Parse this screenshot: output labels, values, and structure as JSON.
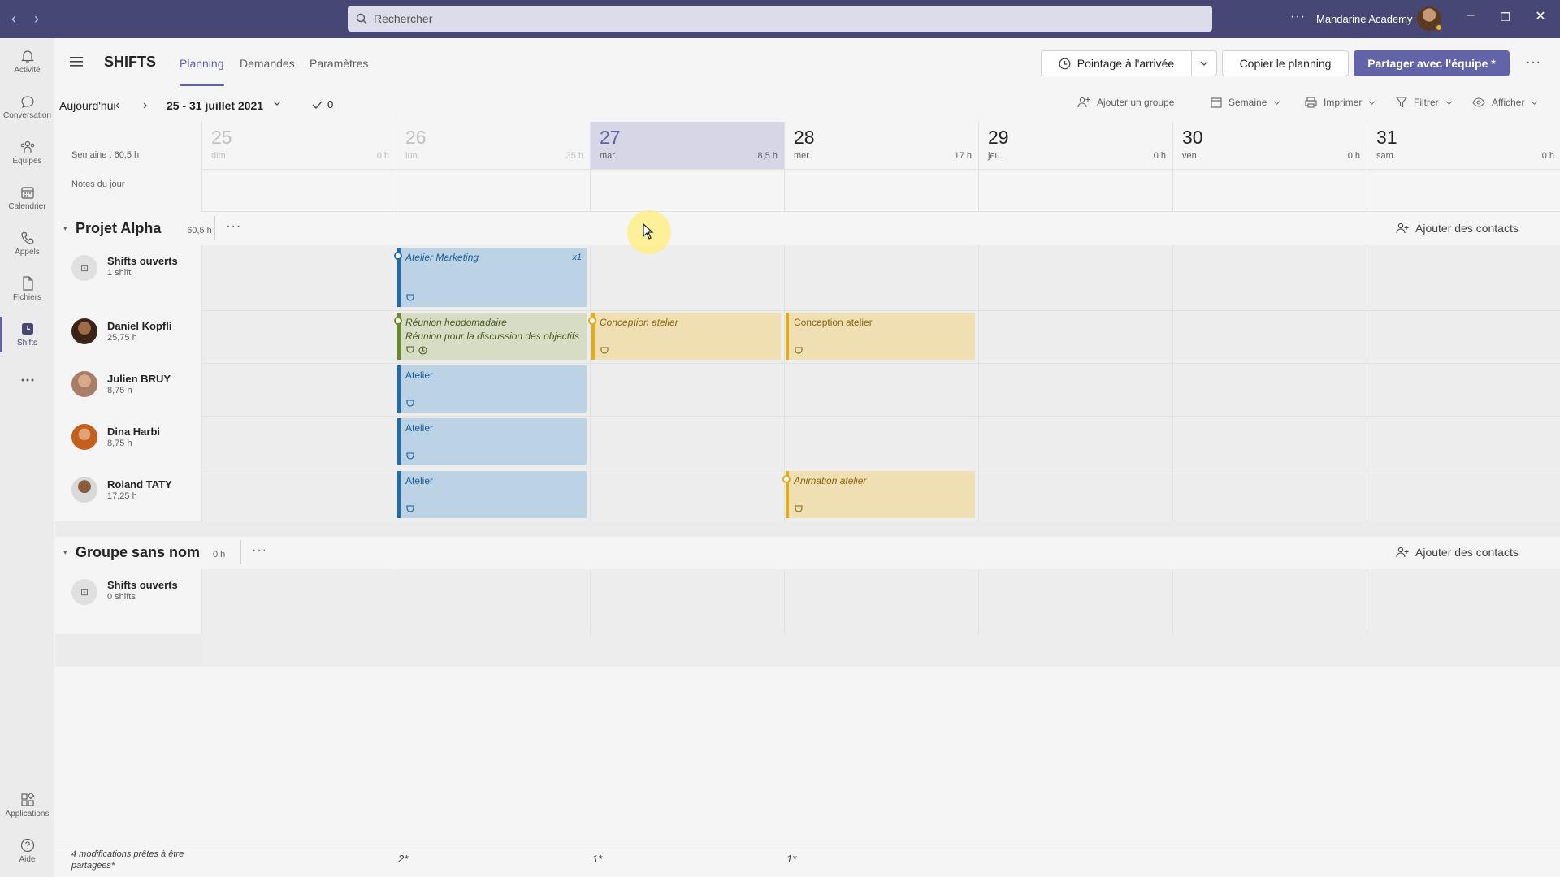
{
  "titlebar": {
    "search_placeholder": "Rechercher",
    "org_name": "Mandarine Academy",
    "more": "···"
  },
  "rail": {
    "items": [
      {
        "label": "Activité",
        "icon": "bell-icon"
      },
      {
        "label": "Conversation",
        "icon": "chat-icon"
      },
      {
        "label": "Équipes",
        "icon": "teams-icon"
      },
      {
        "label": "Calendrier",
        "icon": "calendar-icon"
      },
      {
        "label": "Appels",
        "icon": "phone-icon"
      },
      {
        "label": "Fichiers",
        "icon": "file-icon"
      },
      {
        "label": "Shifts",
        "icon": "shifts-icon",
        "active": true
      },
      {
        "label": "···",
        "icon": "more-icon"
      }
    ],
    "bottom": [
      {
        "label": "Applications",
        "icon": "apps-icon"
      },
      {
        "label": "Aide",
        "icon": "help-icon"
      }
    ]
  },
  "app": {
    "title": "SHIFTS",
    "tabs": [
      "Planning",
      "Demandes",
      "Paramètres"
    ],
    "active_tab": "Planning",
    "buttons": {
      "clock": "Pointage à l'arrivée",
      "copy": "Copier le planning",
      "share": "Partager avec l'équipe *"
    }
  },
  "toolbar": {
    "today": "Aujourd'hui",
    "range": "25 - 31 juillet 2021",
    "check_count": "0",
    "add_group": "Ajouter un groupe",
    "view": "Semaine",
    "print": "Imprimer",
    "filter": "Filtrer",
    "show": "Afficher"
  },
  "week": {
    "summary": "Semaine : 60,5 h",
    "notes_label": "Notes du jour",
    "days": [
      {
        "num": "25",
        "name": "dim.",
        "hours": "0 h",
        "past": true
      },
      {
        "num": "26",
        "name": "lun.",
        "hours": "35 h",
        "past": true
      },
      {
        "num": "27",
        "name": "mar.",
        "hours": "8,5 h",
        "today": true
      },
      {
        "num": "28",
        "name": "mer.",
        "hours": "17 h"
      },
      {
        "num": "29",
        "name": "jeu.",
        "hours": "0 h"
      },
      {
        "num": "30",
        "name": "ven.",
        "hours": "0 h"
      },
      {
        "num": "31",
        "name": "sam.",
        "hours": "0 h"
      }
    ]
  },
  "groups": [
    {
      "title": "Projet Alpha",
      "hours": "60,5 h",
      "add_contacts": "Ajouter des contacts",
      "open_shifts": {
        "title": "Shifts ouverts",
        "count": "1 shift"
      },
      "open_shift_items": [
        {
          "day": 1,
          "title": "Atelier Marketing",
          "count": "x1",
          "color": "blue",
          "draft": true
        }
      ],
      "members": [
        {
          "name": "Daniel Kopfli",
          "hours": "25,75 h",
          "shifts": [
            {
              "day": 1,
              "title": "Réunion hebdomadaire",
              "subtitle": "Réunion pour la discussion des objectifs",
              "color": "green",
              "draft": true,
              "clock": true
            },
            {
              "day": 2,
              "title": "Conception atelier",
              "color": "yellow",
              "draft": true
            },
            {
              "day": 3,
              "title": "Conception atelier",
              "color": "yellow",
              "draft": false
            }
          ]
        },
        {
          "name": "Julien BRUY",
          "hours": "8,75 h",
          "shifts": [
            {
              "day": 1,
              "title": "Atelier",
              "color": "blue",
              "draft": false
            }
          ]
        },
        {
          "name": "Dina Harbi",
          "hours": "8,75 h",
          "shifts": [
            {
              "day": 1,
              "title": "Atelier",
              "color": "blue",
              "draft": false
            }
          ]
        },
        {
          "name": "Roland TATY",
          "hours": "17,25 h",
          "shifts": [
            {
              "day": 1,
              "title": "Atelier",
              "color": "blue",
              "draft": false
            },
            {
              "day": 3,
              "title": "Animation atelier",
              "color": "yellow",
              "draft": true
            }
          ]
        }
      ]
    },
    {
      "title": "Groupe sans nom",
      "hours": "0 h",
      "add_contacts": "Ajouter des contacts",
      "open_shifts": {
        "title": "Shifts ouverts",
        "count": "0 shifts"
      }
    }
  ],
  "footer": {
    "pending": "4 modifications prêtes à être partagées*",
    "marks": [
      {
        "day": 1,
        "text": "2*"
      },
      {
        "day": 2,
        "text": "1*"
      },
      {
        "day": 3,
        "text": "1*"
      }
    ]
  },
  "colors": {
    "titlebar": "#464775",
    "accent": "#6264a7",
    "shift_blue": "#bcd3e6",
    "shift_green": "#d7dcc5",
    "shift_yellow": "#f0dfb2"
  }
}
